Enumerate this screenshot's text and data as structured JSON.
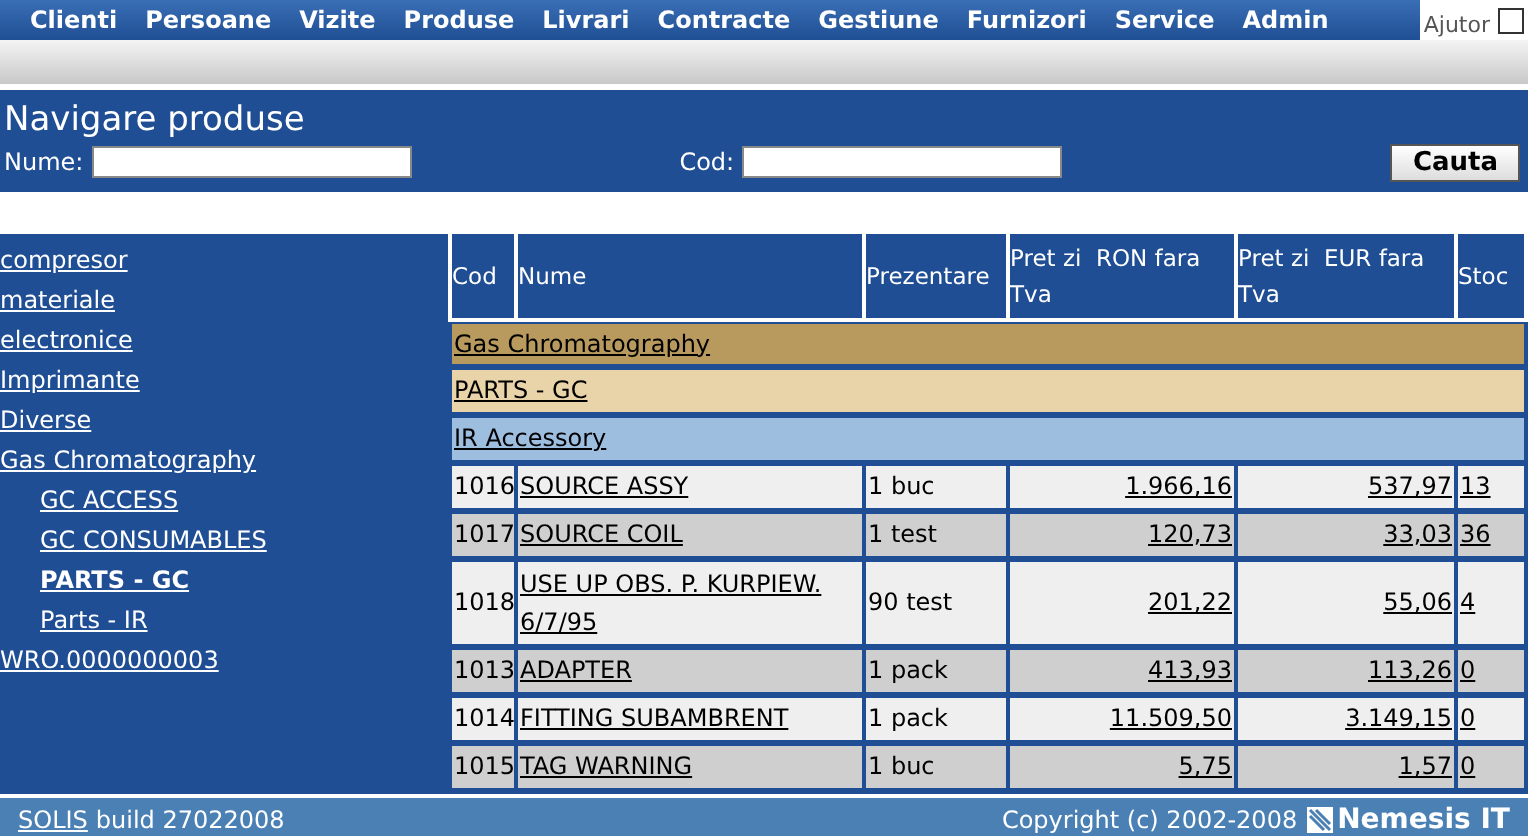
{
  "menu": [
    "Clienti",
    "Persoane",
    "Vizite",
    "Produse",
    "Livrari",
    "Contracte",
    "Gestiune",
    "Furnizori",
    "Service",
    "Admin"
  ],
  "help": {
    "label": "Ajutor",
    "checked": false
  },
  "header": {
    "title": "Navigare produse",
    "fields": [
      {
        "label": "Nume:"
      },
      {
        "label": "Cod:"
      }
    ],
    "button": "Cauta"
  },
  "sidebar": {
    "items": [
      {
        "label": "compresor",
        "selected": false
      },
      {
        "label": "materiale",
        "selected": false
      },
      {
        "label": "electronice",
        "selected": false
      },
      {
        "label": "Imprimante",
        "selected": false
      },
      {
        "label": "Diverse",
        "selected": false
      },
      {
        "label": "Gas Chromatography",
        "selected": false,
        "children": [
          {
            "label": "GC ACCESS",
            "selected": false
          },
          {
            "label": "GC CONSUMABLES",
            "selected": false
          },
          {
            "label": "PARTS - GC",
            "selected": true
          },
          {
            "label": "Parts - IR",
            "selected": false
          }
        ]
      },
      {
        "label": "WRO.0000000003",
        "selected": false
      }
    ]
  },
  "table": {
    "columns": [
      "Cod",
      "Nume",
      "Prezentare",
      "Pret zi  RON fara Tva",
      "Pret zi  EUR fara Tva",
      "Stoc"
    ],
    "rows": [
      {
        "kind": "category",
        "label": "Gas Chromatography"
      },
      {
        "kind": "subcategory",
        "label": "PARTS - GC"
      },
      {
        "kind": "group",
        "label": "IR Accessory"
      },
      {
        "kind": "product",
        "cells": [
          "1016",
          "SOURCE ASSY",
          "1 buc",
          "1.966,16",
          "537,97",
          "13"
        ]
      },
      {
        "kind": "product",
        "cells": [
          "1017",
          "SOURCE COIL",
          "1 test",
          "120,73",
          "33,03",
          "36"
        ]
      },
      {
        "kind": "product",
        "cells": [
          "1018",
          "USE UP OBS. P. KURPIEW. 6/7/95",
          "90 test",
          "201,22",
          "55,06",
          "4"
        ]
      },
      {
        "kind": "product",
        "cells": [
          "1013",
          "ADAPTER",
          "1 pack",
          "413,93",
          "113,26",
          "0"
        ]
      },
      {
        "kind": "product",
        "cells": [
          "1014",
          "FITTING SUBAMBRENT",
          "1 pack",
          "11.509,50",
          "3.149,15",
          "0"
        ]
      },
      {
        "kind": "product",
        "cells": [
          "1015",
          "TAG WARNING",
          "1 buc",
          "5,75",
          "1,57",
          "0"
        ]
      }
    ]
  },
  "footer": {
    "link": "SOLIS",
    "build": "build 27022008",
    "copyright": "Copyright (c) 2002-2008",
    "logo": "Nemesis IT"
  }
}
